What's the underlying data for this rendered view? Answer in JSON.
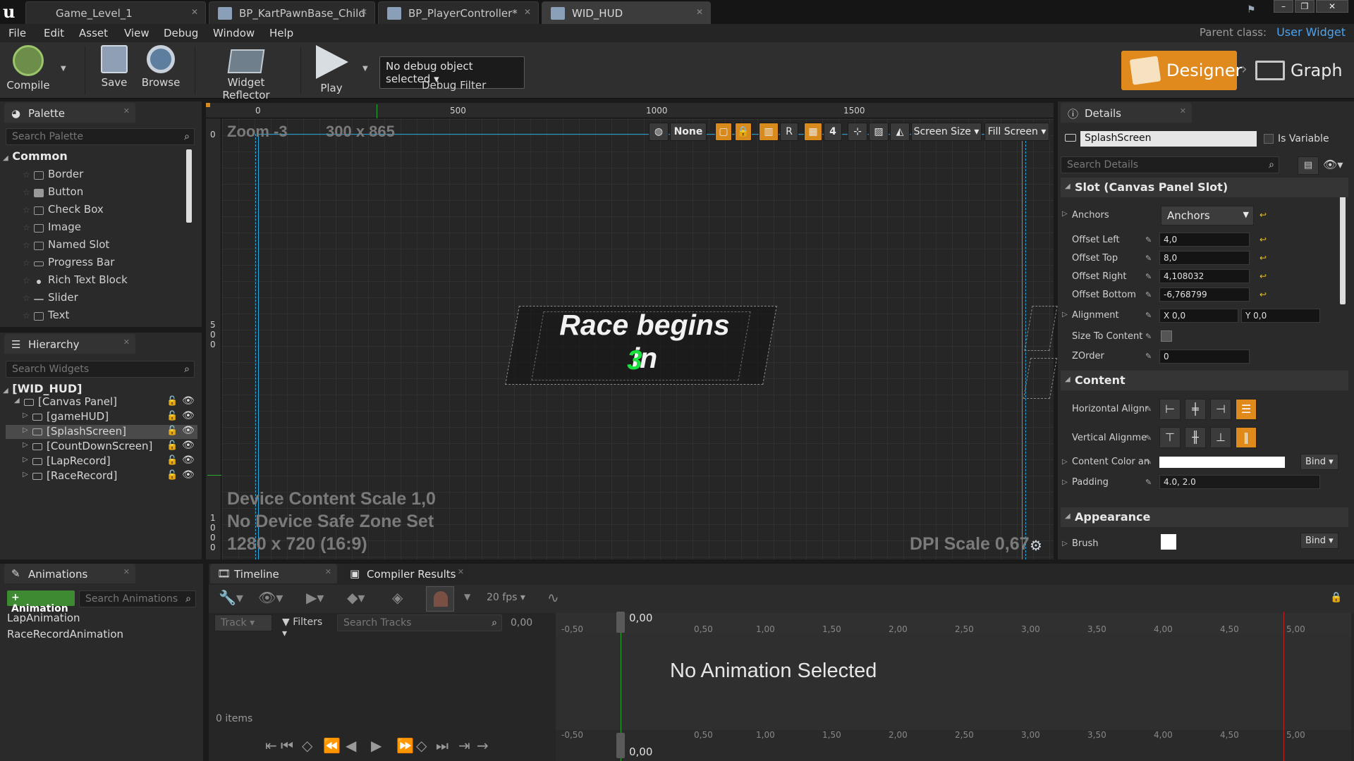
{
  "tabs": [
    {
      "label": "Game_Level_1"
    },
    {
      "label": "BP_KartPawnBase_Child"
    },
    {
      "label": "BP_PlayerController*"
    },
    {
      "label": "WID_HUD"
    }
  ],
  "menu": [
    "File",
    "Edit",
    "Asset",
    "View",
    "Debug",
    "Window",
    "Help"
  ],
  "parent": {
    "label": "Parent class:",
    "value": "User Widget"
  },
  "toolbar": {
    "compile": "Compile",
    "save": "Save",
    "browse": "Browse",
    "widget_reflector": "Widget Reflector",
    "play": "Play",
    "debug_object": "No debug object selected",
    "debug_filter": "Debug Filter",
    "designer": "Designer",
    "graph": "Graph"
  },
  "palette": {
    "title": "Palette",
    "search_placeholder": "Search Palette",
    "category": "Common",
    "items": [
      "Border",
      "Button",
      "Check Box",
      "Image",
      "Named Slot",
      "Progress Bar",
      "Rich Text Block",
      "Slider",
      "Text"
    ]
  },
  "hierarchy": {
    "title": "Hierarchy",
    "search_placeholder": "Search Widgets",
    "root": "[WID_HUD]",
    "rows": [
      "[Canvas Panel]",
      "[gameHUD]",
      "[SplashScreen]",
      "[CountDownScreen]",
      "[LapRecord]",
      "[RaceRecord]"
    ]
  },
  "designer_canvas": {
    "ruler_top": [
      "0",
      "500",
      "1000",
      "1500"
    ],
    "ruler_left": [
      "0",
      "5",
      "0",
      "0",
      "1",
      "0",
      "0",
      "0"
    ],
    "zoom": "Zoom -3",
    "size": "300 x 865",
    "splash_title": "Race begins in",
    "splash_count": "3",
    "device_scale": "Device Content Scale 1,0",
    "safe_zone": "No Device Safe Zone Set",
    "resolution": "1280 x 720 (16:9)",
    "dpi": "DPI Scale 0,67",
    "tools": {
      "none": "None",
      "r": "R",
      "grid": "4",
      "screen_size": "Screen Size",
      "fill_screen": "Fill Screen"
    }
  },
  "details": {
    "title": "Details",
    "widget_name": "SplashScreen",
    "is_variable": "Is Variable",
    "search_placeholder": "Search Details",
    "slot_section": "Slot (Canvas Panel Slot)",
    "anchors_label": "Anchors",
    "anchors_value": "Anchors",
    "fields": [
      {
        "label": "Offset Left",
        "value": "4,0"
      },
      {
        "label": "Offset Top",
        "value": "8,0"
      },
      {
        "label": "Offset Right",
        "value": "4,108032"
      },
      {
        "label": "Offset Bottom",
        "value": "-6,768799"
      }
    ],
    "alignment_label": "Alignment",
    "alignment_x": "X  0,0",
    "alignment_y": "Y  0,0",
    "size_to_content": "Size To Content",
    "zorder_label": "ZOrder",
    "zorder_value": "0",
    "content_section": "Content",
    "h_align": "Horizontal Alignr",
    "v_align": "Vertical Alignme",
    "content_color": "Content Color an",
    "bind": "Bind",
    "padding_label": "Padding",
    "padding_value": "4.0, 2.0",
    "appearance_section": "Appearance",
    "brush": "Brush"
  },
  "animations": {
    "title": "Animations",
    "add": "+ Animation",
    "search_placeholder": "Search Animations",
    "items": [
      "LapAnimation",
      "RaceRecordAnimation"
    ]
  },
  "timeline": {
    "title": "Timeline",
    "compiler": "Compiler Results",
    "fps": "20 fps",
    "track": "Track",
    "filters": "Filters",
    "search_tracks": "Search Tracks",
    "time": "0,00",
    "head_time": "0,00",
    "ticks": [
      "-0,50",
      "0,00",
      "0,50",
      "1,00",
      "1,50",
      "2,00",
      "2,50",
      "3,00",
      "3,50",
      "4,00",
      "4,50",
      "5,00"
    ],
    "no_anim": "No Animation Selected",
    "items_count": "0 items"
  },
  "colors": {
    "accent": "#e08a1e",
    "link": "#4aa3f0",
    "count_green": "#19e03c"
  }
}
